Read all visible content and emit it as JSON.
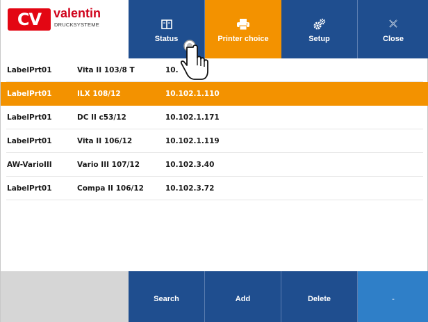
{
  "brand": {
    "mark": "CV",
    "name": "valentin",
    "subtitle": "DRUCKSYSTEME"
  },
  "toolbar": {
    "status_label": "Status",
    "printer_choice_label": "Printer choice",
    "setup_label": "Setup",
    "close_label": "Close",
    "active_tab": "Printer choice"
  },
  "printers": [
    {
      "name": "LabelPrt01",
      "model": "Vita II 103/8 T",
      "ip": "10.",
      "selected": false
    },
    {
      "name": "LabelPrt01",
      "model": "ILX 108/12",
      "ip": "10.102.1.110",
      "selected": true
    },
    {
      "name": "LabelPrt01",
      "model": "DC II c53/12",
      "ip": "10.102.1.171",
      "selected": false
    },
    {
      "name": "LabelPrt01",
      "model": "Vita II 106/12",
      "ip": "10.102.1.119",
      "selected": false
    },
    {
      "name": "AW-VarioIII",
      "model": "Vario III 107/12",
      "ip": "10.102.3.40",
      "selected": false
    },
    {
      "name": "LabelPrt01",
      "model": "Compa II 106/12",
      "ip": "10.102.3.72",
      "selected": false
    }
  ],
  "footer": {
    "search_label": "Search",
    "add_label": "Add",
    "delete_label": "Delete",
    "extra_label": "-"
  },
  "colors": {
    "blue": "#1f4e8f",
    "orange": "#f39200",
    "brand_red": "#e30613",
    "light_blue": "#2f7fc8",
    "grey": "#d6d6d6"
  },
  "icons": {
    "status": "book-icon",
    "printer_choice": "printer-icon",
    "setup": "gears-icon",
    "close": "close-x-icon",
    "pointer": "hand-pointer-icon"
  }
}
